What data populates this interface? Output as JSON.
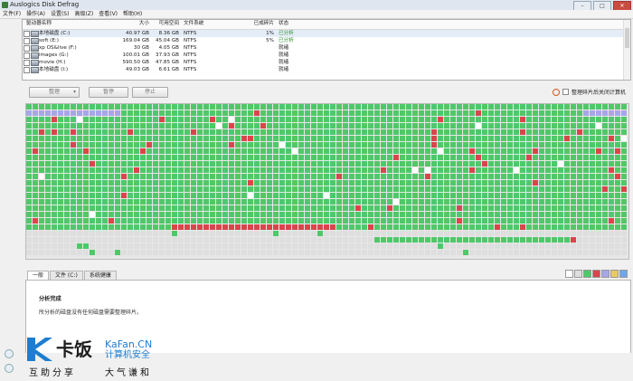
{
  "window": {
    "title": "Auslogics Disk Defrag",
    "min": "–",
    "max": "□",
    "close": "✕"
  },
  "menu": [
    "文件(F)",
    "操作(A)",
    "设置(S)",
    "高级(Z)",
    "查看(V)",
    "帮助(H)"
  ],
  "drives": {
    "headers": {
      "name": "驱动器名称",
      "size": "大小",
      "free": "可用空间",
      "fs": "文件系统",
      "frag": "已成碎片",
      "status": "状态"
    },
    "rows": [
      {
        "name": "本地磁盘 (C:)",
        "size": "40.97 GB",
        "free": "8.36 GB",
        "fs": "NTFS",
        "frag": "1%",
        "status": "已分析",
        "checked": false
      },
      {
        "name": "soft (E:)",
        "size": "169.04 GB",
        "free": "45.04 GB",
        "fs": "NTFS",
        "frag": "5%",
        "status": "已分析",
        "checked": false
      },
      {
        "name": "xp OS&live (F:)",
        "size": "30 GB",
        "free": "4.05 GB",
        "fs": "NTFS",
        "frag": "",
        "status": "就绪",
        "checked": false
      },
      {
        "name": "images (G:)",
        "size": "100.01 GB",
        "free": "37.93 GB",
        "fs": "NTFS",
        "frag": "",
        "status": "就绪",
        "checked": false
      },
      {
        "name": "movie (H:)",
        "size": "590.50 GB",
        "free": "47.85 GB",
        "fs": "NTFS",
        "frag": "",
        "status": "就绪",
        "checked": false
      },
      {
        "name": "本地磁盘 (I:)",
        "size": "49.03 GB",
        "free": "6.61 GB",
        "fs": "NTFS",
        "frag": "",
        "status": "就绪",
        "checked": false
      }
    ]
  },
  "toolbar": {
    "defrag": "整理",
    "pause": "暂停",
    "stop": "停止",
    "shutdown_label": "整理碎片后关闭计算机"
  },
  "tabs": [
    "一般",
    "文件 (C:)",
    "系统健康"
  ],
  "panel": {
    "heading": "分析完成",
    "message": "所分析的磁盘没有任何磁盘需要整理碎片。"
  },
  "colors": {
    "used": "#4fc869",
    "fragmented": "#d8464b",
    "free": "#dedede",
    "mft": "#a7a6e8",
    "system": "#ffffff"
  },
  "legend_colors": [
    "#ffffff",
    "#dedede",
    "#4fc869",
    "#d8464b",
    "#a7a6e8",
    "#e8c86a",
    "#6ea7e8"
  ],
  "logo": {
    "cn": "卡饭",
    "en": "KaFan.CN",
    "sub": "计算机安全",
    "slogan1": "互助分享",
    "slogan2": "大气谦和"
  }
}
